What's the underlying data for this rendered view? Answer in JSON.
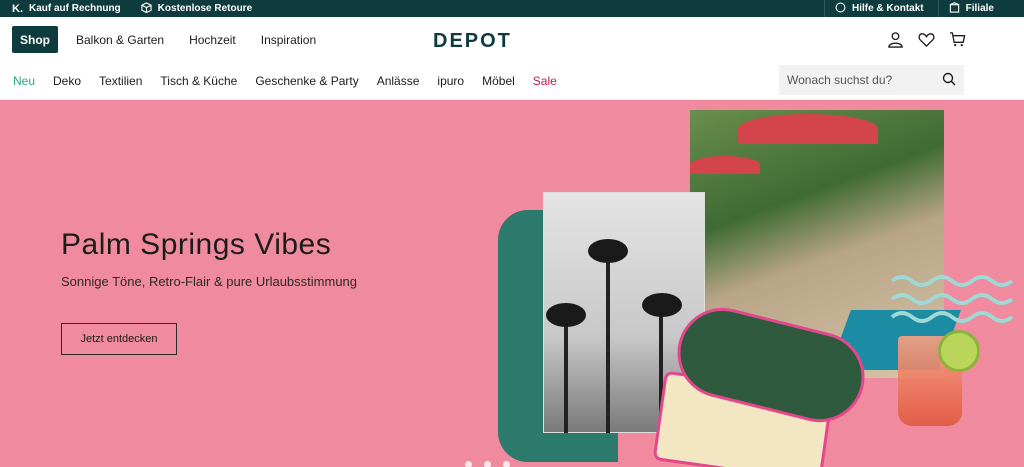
{
  "topbar": {
    "invoice": "Kauf auf Rechnung",
    "returns": "Kostenlose Retoure",
    "help": "Hilfe & Kontakt",
    "store": "Filiale"
  },
  "header": {
    "shop": "Shop",
    "nav": [
      "Balkon & Garten",
      "Hochzeit",
      "Inspiration"
    ],
    "logo": "DEPOT"
  },
  "catnav": {
    "items": [
      "Neu",
      "Deko",
      "Textilien",
      "Tisch & Küche",
      "Geschenke & Party",
      "Anlässe",
      "ipuro",
      "Möbel",
      "Sale"
    ]
  },
  "search": {
    "placeholder": "Wonach suchst du?"
  },
  "hero": {
    "title": "Palm Springs Vibes",
    "subtitle": "Sonnige Töne, Retro-Flair & pure Urlaubsstimmung",
    "cta": "Jetzt entdecken",
    "slides": 3,
    "active_slide": 1
  },
  "colors": {
    "brand": "#0d3b3e",
    "hero_bg": "#f08a9e",
    "new": "#2aa87d",
    "sale": "#c2185b"
  }
}
